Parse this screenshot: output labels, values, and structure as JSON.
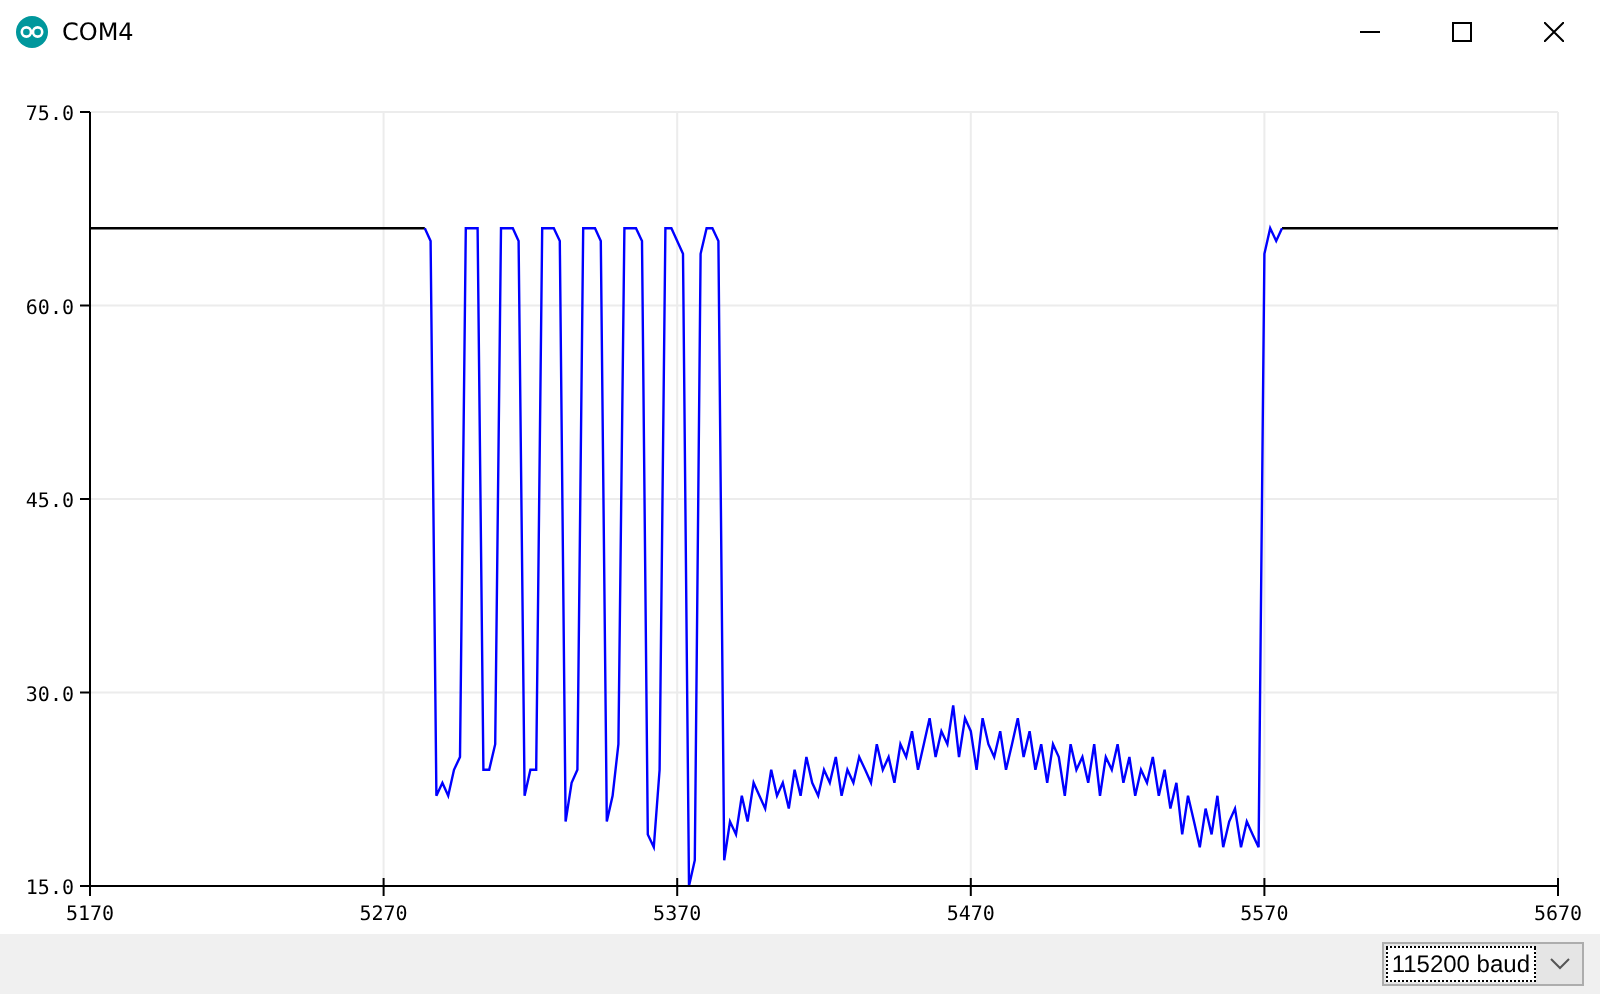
{
  "window": {
    "title": "COM4"
  },
  "plot": {
    "chart_data": {
      "type": "line",
      "grid": true,
      "xlim": [
        5170,
        5670
      ],
      "ylim": [
        15,
        75
      ],
      "xticks": [
        5170,
        5270,
        5370,
        5470,
        5570,
        5670
      ],
      "yticks": [
        {
          "value": 15,
          "label": "15.0"
        },
        {
          "value": 30,
          "label": "30.0"
        },
        {
          "value": 45,
          "label": "45.0"
        },
        {
          "value": 60,
          "label": "60.0"
        },
        {
          "value": 75,
          "label": "75.0"
        }
      ],
      "x": [
        5170,
        5284,
        5286,
        5288,
        5290,
        5292,
        5294,
        5296,
        5298,
        5300,
        5302,
        5304,
        5306,
        5308,
        5310,
        5312,
        5314,
        5316,
        5318,
        5320,
        5322,
        5324,
        5326,
        5328,
        5330,
        5332,
        5334,
        5336,
        5338,
        5340,
        5342,
        5344,
        5346,
        5348,
        5350,
        5352,
        5354,
        5356,
        5358,
        5360,
        5362,
        5364,
        5366,
        5368,
        5370,
        5372,
        5374,
        5376,
        5378,
        5380,
        5382,
        5384,
        5386,
        5388,
        5390,
        5392,
        5394,
        5396,
        5398,
        5400,
        5402,
        5404,
        5406,
        5408,
        5410,
        5412,
        5414,
        5416,
        5418,
        5420,
        5422,
        5424,
        5426,
        5428,
        5430,
        5432,
        5434,
        5436,
        5438,
        5440,
        5442,
        5444,
        5446,
        5448,
        5450,
        5452,
        5454,
        5456,
        5458,
        5460,
        5462,
        5464,
        5466,
        5468,
        5470,
        5472,
        5474,
        5476,
        5478,
        5480,
        5482,
        5484,
        5486,
        5488,
        5490,
        5492,
        5494,
        5496,
        5498,
        5500,
        5502,
        5504,
        5506,
        5508,
        5510,
        5512,
        5514,
        5516,
        5518,
        5520,
        5522,
        5524,
        5526,
        5528,
        5530,
        5532,
        5534,
        5536,
        5538,
        5540,
        5542,
        5544,
        5546,
        5548,
        5550,
        5552,
        5554,
        5556,
        5558,
        5560,
        5562,
        5564,
        5566,
        5568,
        5570,
        5572,
        5574,
        5576,
        5670
      ],
      "series": [
        {
          "color": "#000000",
          "values": [
            66,
            66,
            null,
            null,
            null,
            null,
            null,
            null,
            null,
            null,
            null,
            null,
            null,
            null,
            null,
            null,
            null,
            null,
            null,
            null,
            null,
            null,
            null,
            null,
            null,
            null,
            null,
            null,
            null,
            null,
            null,
            null,
            null,
            null,
            null,
            null,
            null,
            null,
            null,
            null,
            null,
            null,
            null,
            null,
            null,
            null,
            null,
            null,
            null,
            null,
            null,
            null,
            null,
            null,
            null,
            null,
            null,
            null,
            null,
            null,
            null,
            null,
            null,
            null,
            null,
            null,
            null,
            null,
            null,
            null,
            null,
            null,
            null,
            null,
            null,
            null,
            null,
            null,
            null,
            null,
            null,
            null,
            null,
            null,
            null,
            null,
            null,
            null,
            null,
            null,
            null,
            null,
            null,
            null,
            null,
            null,
            null,
            null,
            null,
            null,
            null,
            null,
            null,
            null,
            null,
            null,
            null,
            null,
            null,
            null,
            null,
            null,
            null,
            null,
            null,
            null,
            null,
            null,
            null,
            null,
            null,
            null,
            null,
            null,
            null,
            null,
            null,
            null,
            null,
            null,
            null,
            null,
            null,
            null,
            null,
            null,
            null,
            null,
            null,
            null,
            null,
            null,
            null,
            null,
            null,
            null,
            null,
            66,
            66
          ]
        },
        {
          "color": "#0000ff",
          "values": [
            null,
            66,
            65,
            22,
            23,
            22,
            24,
            25,
            66,
            66,
            66,
            24,
            24,
            26,
            66,
            66,
            66,
            65,
            22,
            24,
            24,
            66,
            66,
            66,
            65,
            20,
            23,
            24,
            66,
            66,
            66,
            65,
            20,
            22,
            26,
            66,
            66,
            66,
            65,
            19,
            18,
            24,
            66,
            66,
            65,
            64,
            15,
            17,
            64,
            66,
            66,
            65,
            17,
            20,
            19,
            22,
            20,
            23,
            22,
            21,
            24,
            22,
            23,
            21,
            24,
            22,
            25,
            23,
            22,
            24,
            23,
            25,
            22,
            24,
            23,
            25,
            24,
            23,
            26,
            24,
            25,
            23,
            26,
            25,
            27,
            24,
            26,
            28,
            25,
            27,
            26,
            29,
            25,
            28,
            27,
            24,
            28,
            26,
            25,
            27,
            24,
            26,
            28,
            25,
            27,
            24,
            26,
            23,
            26,
            25,
            22,
            26,
            24,
            25,
            23,
            26,
            22,
            25,
            24,
            26,
            23,
            25,
            22,
            24,
            23,
            25,
            22,
            24,
            21,
            23,
            19,
            22,
            20,
            18,
            21,
            19,
            22,
            18,
            20,
            21,
            18,
            20,
            19,
            18,
            64,
            66,
            65,
            66,
            null
          ]
        }
      ]
    }
  },
  "baud_select": {
    "value": "115200 baud"
  }
}
